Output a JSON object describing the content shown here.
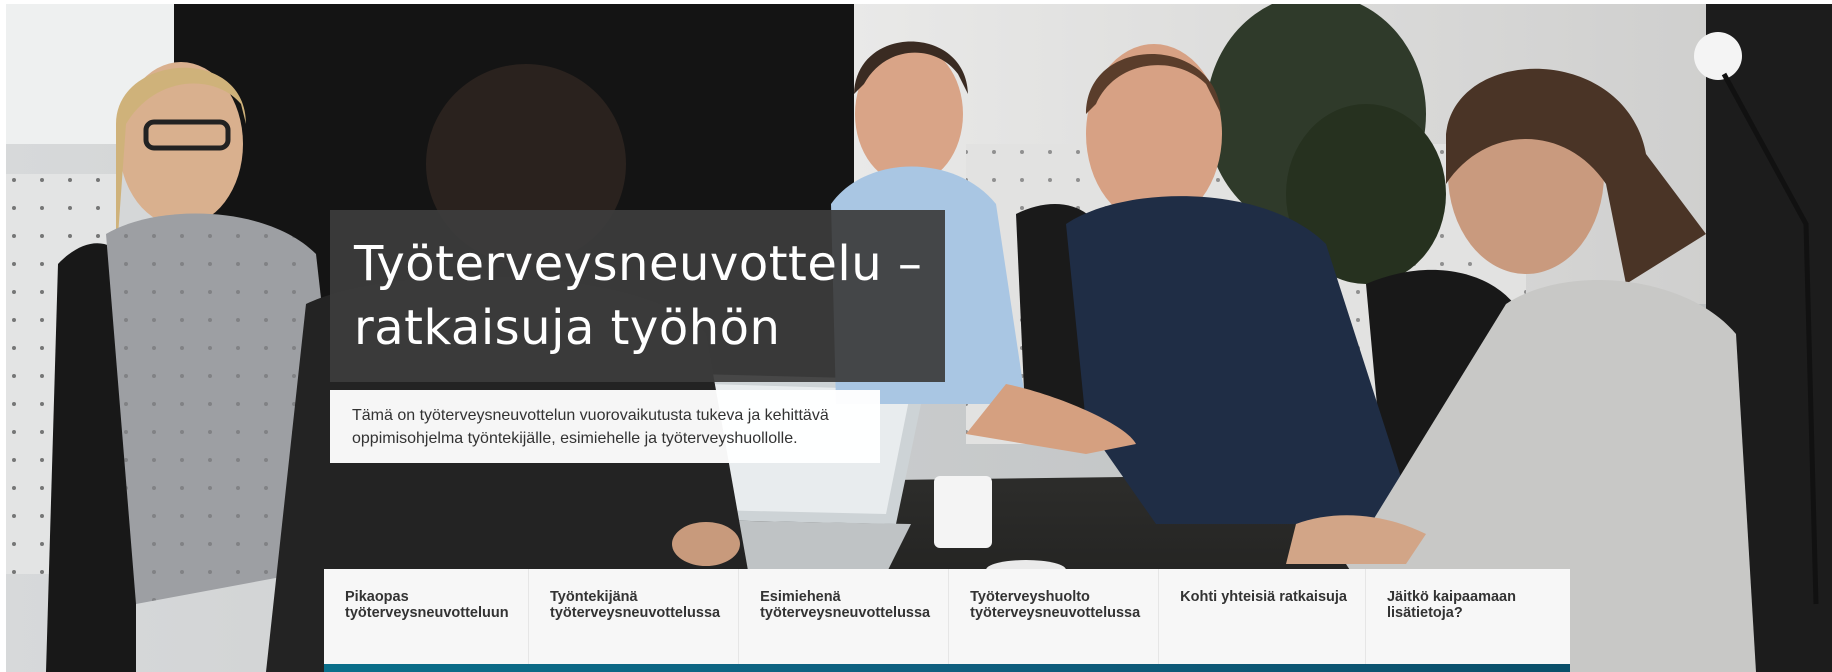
{
  "hero": {
    "title_lines": [
      "Työterveysneuvottelu –",
      "ratkaisuja työhön"
    ],
    "intro_lines": [
      "Tämä on työterveysneuvottelun vuorovaikutusta tukeva ja kehittävä",
      "oppimisohjelma työntekijälle, esimiehelle ja työterveyshuollolle."
    ],
    "photo_icon": "meeting-photo"
  },
  "nav": {
    "items": [
      {
        "lines": [
          "Pikaopas",
          "työterveysneuvotteluun"
        ]
      },
      {
        "lines": [
          "Työntekijänä",
          "työterveysneuvottelussa"
        ]
      },
      {
        "lines": [
          "Esimiehenä",
          "työterveysneuvottelussa"
        ]
      },
      {
        "lines": [
          "Työterveyshuolto",
          "työterveysneuvottelussa"
        ]
      },
      {
        "lines": [
          "Kohti yhteisiä ratkaisuja"
        ]
      },
      {
        "lines": [
          "Jäitkö kaipaamaan",
          "lisätietoja?"
        ]
      }
    ]
  },
  "colors": {
    "title_box": "#3c3c3c",
    "accent_bar": "#0a6f8a",
    "nav_bg": "#f7f7f7"
  }
}
